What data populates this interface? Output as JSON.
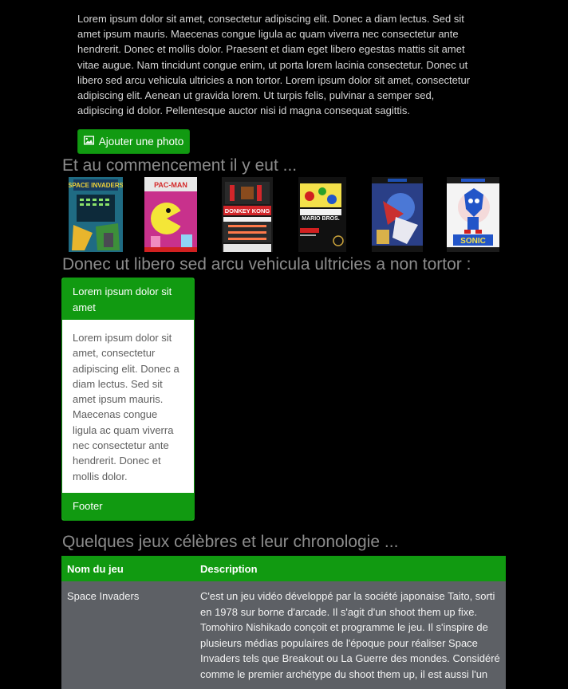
{
  "intro": {
    "text": "Lorem ipsum dolor sit amet, consectetur adipiscing elit. Donec a diam lectus. Sed sit amet ipsum mauris. Maecenas congue ligula ac quam viverra nec consectetur ante hendrerit. Donec et mollis dolor. Praesent et diam eget libero egestas mattis sit amet vitae augue. Nam tincidunt congue enim, ut porta lorem lacinia consectetur. Donec ut libero sed arcu vehicula ultricies a non tortor. Lorem ipsum dolor sit amet, consectetur adipiscing elit. Aenean ut gravida lorem. Ut turpis felis, pulvinar a semper sed, adipiscing id dolor. Pellentesque auctor nisi id magna consequat sagittis.",
    "button_label": "Ajouter une photo"
  },
  "gallery": {
    "heading": "Et au commencement il y eut ...",
    "covers": [
      {
        "title": "SPACE INVADERS",
        "bg": "#1f6b83",
        "accent": "#f0d23a"
      },
      {
        "title": "PAC-MAN",
        "bg": "#c8318c",
        "accent": "#f4e637"
      },
      {
        "title": "DONKEY KONG",
        "bg": "#1a1a1a",
        "accent": "#d3262a"
      },
      {
        "title": "MARIO BROS.",
        "bg": "#111111",
        "accent": "#f3e04a"
      },
      {
        "title": "",
        "bg": "#2a3f87",
        "accent": "#c93030"
      },
      {
        "title": "SONIC",
        "bg": "#f4f4f4",
        "accent": "#2255c8"
      }
    ]
  },
  "card_section": {
    "heading": "Donec ut libero sed arcu vehicula ultricies a non tortor :",
    "header": "Lorem ipsum dolor sit amet",
    "body": "Lorem ipsum dolor sit amet, consectetur adipiscing elit. Donec a diam lectus. Sed sit amet ipsum mauris. Maecenas congue ligula ac quam viverra nec consectetur ante hendrerit. Donec et mollis dolor.",
    "footer": "Footer"
  },
  "table_section": {
    "heading": "Quelques jeux célèbres et leur chronologie ...",
    "columns": [
      "Nom du jeu",
      "Description"
    ],
    "rows": [
      {
        "name": "Space Invaders",
        "description": "C'est un jeu vidéo développé par la société japonaise Taito, sorti en 1978 sur borne d'arcade. Il s'agit d'un shoot them up fixe. Tomohiro Nishikado conçoit et programme le jeu. Il s'inspire de plusieurs médias populaires de l'époque pour réaliser Space Invaders tels que Breakout ou La Guerre des mondes. Considéré comme le premier archétype du shoot them up, il est aussi l'un"
      }
    ]
  },
  "colors": {
    "accent": "#119a11",
    "background": "#000000",
    "table_row": "#5d6065"
  }
}
